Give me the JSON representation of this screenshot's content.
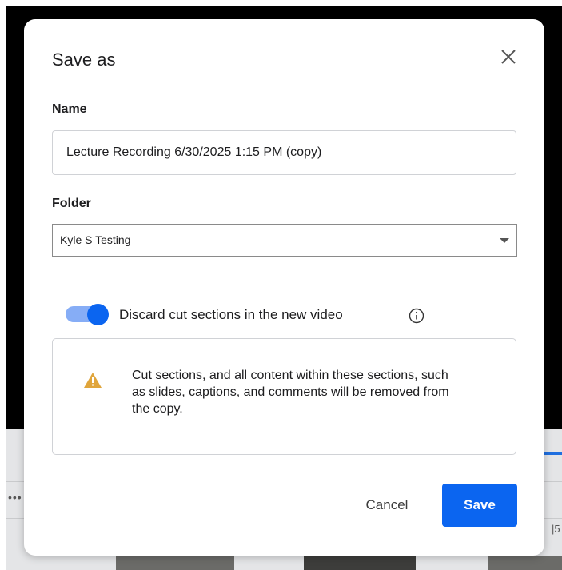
{
  "dialog": {
    "title": "Save as",
    "close_icon": "close-icon"
  },
  "name_field": {
    "label": "Name",
    "value": "Lecture Recording 6/30/2025 1:15 PM (copy)"
  },
  "folder_field": {
    "label": "Folder",
    "selected": "Kyle S Testing"
  },
  "discard_toggle": {
    "label": "Discard cut sections in the new video",
    "enabled": true,
    "info_icon": "info-icon"
  },
  "warning": {
    "icon": "warning-icon",
    "message": "Cut sections, and all content within these sections, such as slides, captions, and comments will be removed from the copy."
  },
  "actions": {
    "cancel_label": "Cancel",
    "save_label": "Save"
  },
  "background": {
    "timeline_more_label": "•••",
    "timeline_tick_label": "|5"
  },
  "colors": {
    "accent": "#0b65f0",
    "toggle_track": "#86adf6",
    "warning": "#e0a53b"
  }
}
